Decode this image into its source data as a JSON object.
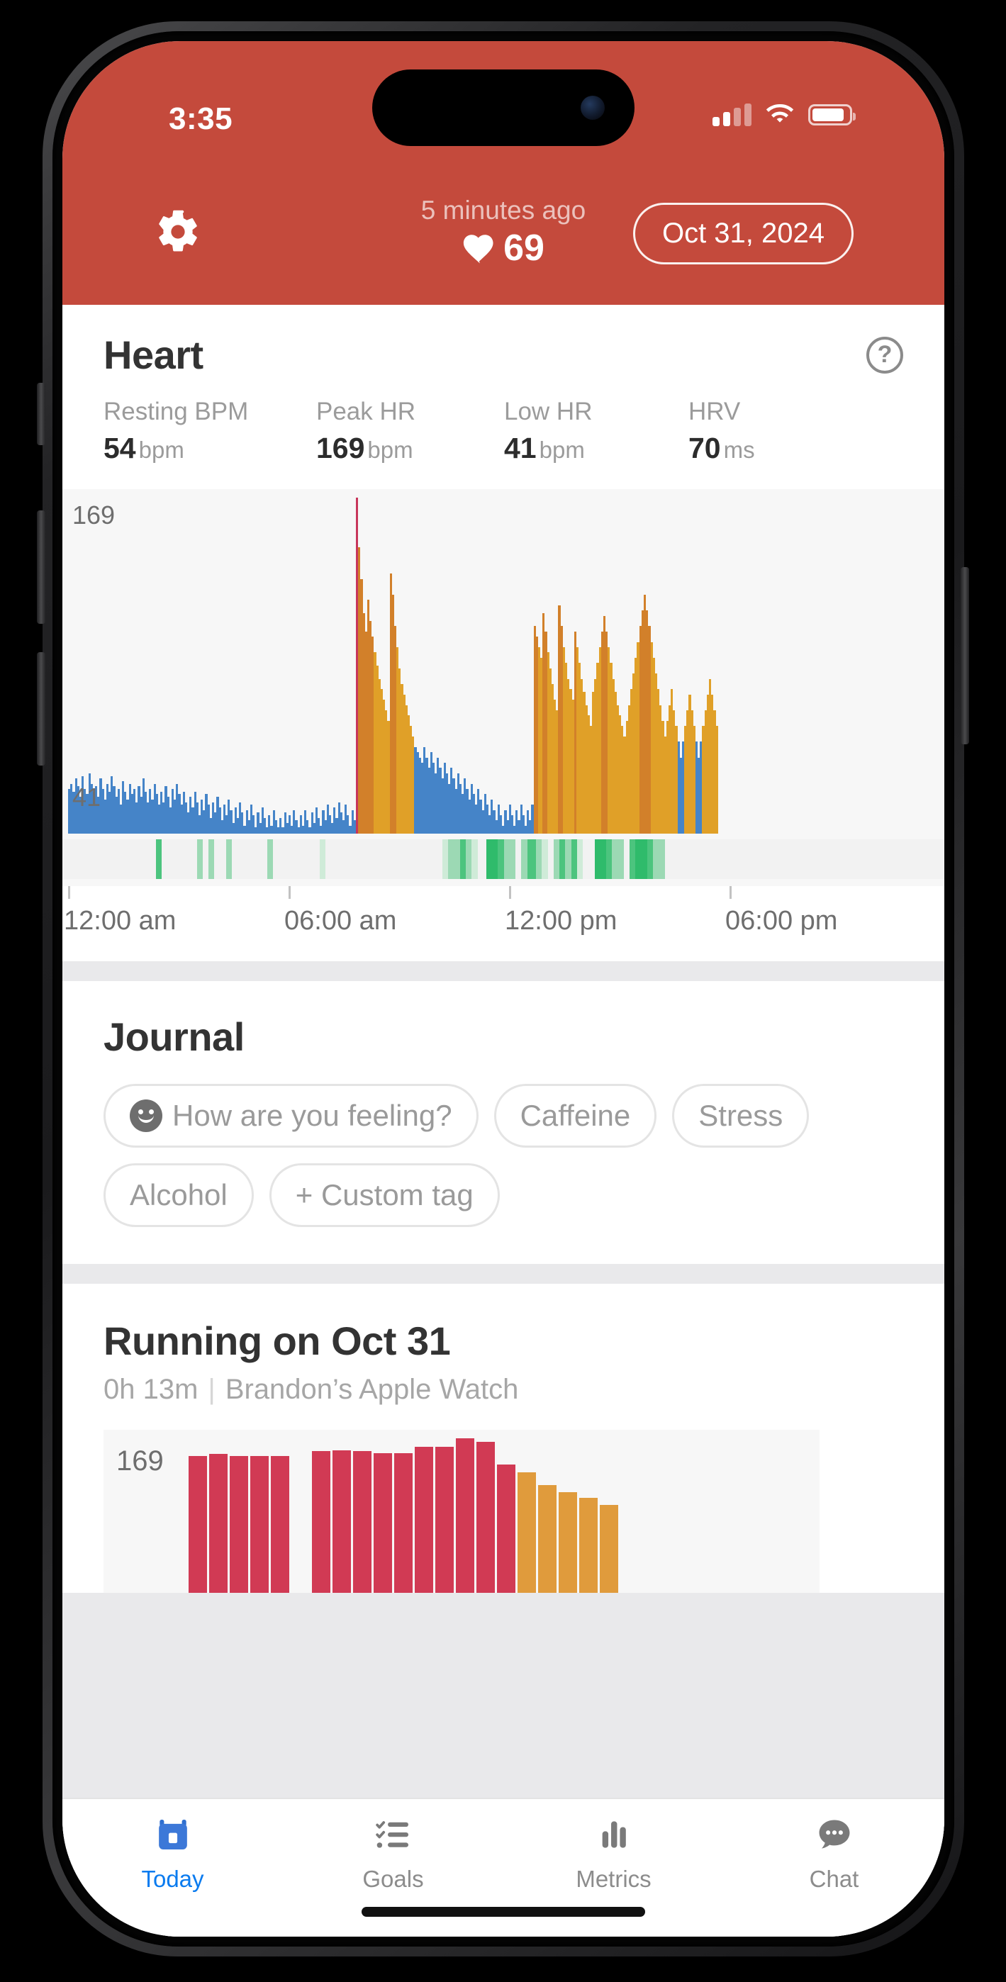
{
  "status_bar": {
    "time": "3:35",
    "signal_icon": "cellular-signal-icon",
    "wifi_icon": "wifi-icon",
    "battery_icon": "battery-icon"
  },
  "header": {
    "settings_icon": "gear-icon",
    "last_reading_ago": "5 minutes ago",
    "heart_icon": "heart-icon",
    "current_bpm": "69",
    "date_pill": "Oct 31, 2024",
    "accent_color": "#C44A3C"
  },
  "heart_card": {
    "title": "Heart",
    "help_icon": "question-mark-icon",
    "help_label": "?",
    "stats": [
      {
        "label": "Resting BPM",
        "value": "54",
        "unit": "bpm"
      },
      {
        "label": "Peak HR",
        "value": "169",
        "unit": "bpm"
      },
      {
        "label": "Low HR",
        "value": "41",
        "unit": "bpm"
      },
      {
        "label": "HRV",
        "value": "70",
        "unit": "ms"
      }
    ]
  },
  "journal": {
    "title": "Journal",
    "chips": [
      {
        "label": "How are you feeling?",
        "icon": "smiley-face-icon"
      },
      {
        "label": "Caffeine",
        "icon": ""
      },
      {
        "label": "Stress",
        "icon": ""
      },
      {
        "label": "Alcohol",
        "icon": ""
      },
      {
        "label": "+ Custom tag",
        "icon": ""
      }
    ]
  },
  "workout_card": {
    "title": "Running on Oct 31",
    "duration": "0h 13m",
    "separator": "|",
    "source": "Brandon’s Apple Watch",
    "max_label": "169"
  },
  "tab_bar": {
    "items": [
      {
        "label": "Today",
        "icon": "calendar-icon",
        "active": true
      },
      {
        "label": "Goals",
        "icon": "checklist-icon",
        "active": false
      },
      {
        "label": "Metrics",
        "icon": "bar-chart-icon",
        "active": false
      },
      {
        "label": "Chat",
        "icon": "speech-bubble-icon",
        "active": false
      }
    ],
    "active_color": "#0A7BEF",
    "inactive_color": "#8C8C8C"
  },
  "chart_data": [
    {
      "id": "day_heart_rate",
      "type": "bar",
      "title": "Heart",
      "xlabel": "",
      "ylabel": "bpm",
      "ylim": [
        41,
        169
      ],
      "ymax_label": "169",
      "ymin_label": "41",
      "grid": false,
      "legend": "none",
      "xtick_labels": [
        "12:00 am",
        "06:00 am",
        "12:00 pm",
        "06:00 pm"
      ],
      "xtick_positions_pct": [
        0,
        25,
        50,
        75
      ],
      "zone_colors": {
        "rest": "#4584C8",
        "moderate": "#E0A028",
        "vigorous": "#D2802A",
        "peak": "#C8365B"
      },
      "values": [
        58,
        60,
        57,
        62,
        59,
        55,
        63,
        58,
        56,
        64,
        60,
        57,
        59,
        55,
        62,
        58,
        54,
        60,
        57,
        63,
        59,
        55,
        58,
        52,
        61,
        57,
        54,
        60,
        56,
        58,
        53,
        59,
        55,
        62,
        57,
        53,
        58,
        54,
        60,
        56,
        52,
        57,
        53,
        59,
        55,
        51,
        58,
        54,
        60,
        56,
        52,
        57,
        53,
        49,
        55,
        51,
        57,
        53,
        48,
        54,
        50,
        56,
        52,
        47,
        53,
        49,
        55,
        51,
        46,
        52,
        48,
        54,
        50,
        45,
        51,
        47,
        53,
        49,
        44,
        50,
        46,
        52,
        48,
        43,
        49,
        45,
        51,
        47,
        42,
        48,
        44,
        50,
        46,
        41,
        47,
        43,
        49,
        45,
        48,
        44,
        50,
        46,
        42,
        48,
        44,
        50,
        46,
        43,
        49,
        45,
        51,
        47,
        44,
        50,
        46,
        52,
        48,
        45,
        51,
        47,
        53,
        49,
        46,
        52,
        48,
        44,
        50,
        46,
        169,
        150,
        138,
        125,
        118,
        130,
        122,
        116,
        110,
        105,
        100,
        96,
        92,
        88,
        84,
        140,
        132,
        120,
        112,
        104,
        98,
        94,
        90,
        86,
        82,
        78,
        74,
        72,
        70,
        68,
        74,
        70,
        66,
        72,
        68,
        64,
        70,
        66,
        62,
        68,
        64,
        60,
        66,
        62,
        58,
        64,
        60,
        56,
        62,
        58,
        54,
        60,
        56,
        52,
        58,
        54,
        50,
        56,
        52,
        48,
        54,
        50,
        46,
        52,
        48,
        44,
        50,
        46,
        52,
        48,
        44,
        50,
        46,
        52,
        48,
        44,
        50,
        46,
        52,
        120,
        116,
        112,
        108,
        125,
        118,
        110,
        104,
        98,
        92,
        88,
        128,
        120,
        112,
        106,
        100,
        96,
        92,
        118,
        112,
        106,
        100,
        95,
        90,
        86,
        82,
        95,
        100,
        106,
        112,
        118,
        124,
        118,
        112,
        106,
        100,
        95,
        90,
        86,
        82,
        78,
        84,
        90,
        96,
        102,
        108,
        114,
        120,
        126,
        132,
        126,
        120,
        114,
        108,
        102,
        96,
        90,
        84,
        78,
        84,
        90,
        96,
        88,
        82,
        76,
        70,
        76,
        82,
        88,
        94,
        88,
        82,
        76,
        70,
        76,
        82,
        88,
        94,
        100,
        94,
        88,
        82,
        0,
        0,
        0,
        0,
        0,
        0,
        0,
        0,
        0,
        0,
        0,
        0,
        0,
        0,
        0,
        0,
        0,
        0,
        0,
        0,
        0,
        0,
        0,
        0,
        0,
        0,
        0,
        0,
        0,
        0,
        0,
        0,
        0,
        0,
        0,
        0,
        0,
        0,
        0,
        0,
        0,
        0,
        0,
        0,
        0,
        0,
        0,
        0,
        0,
        0,
        0,
        0,
        0,
        0,
        0,
        0,
        0,
        0,
        0,
        0,
        0,
        0,
        0,
        0,
        0,
        0,
        0,
        0,
        0,
        0,
        0,
        0,
        0,
        0,
        0,
        0,
        0,
        0,
        0,
        0,
        0,
        0,
        0,
        0,
        0,
        0,
        0,
        0,
        0,
        0,
        0,
        0,
        0,
        0,
        0,
        0,
        0,
        0,
        0,
        0
      ],
      "activity_strip": {
        "label": "activity-intensity-strip",
        "color_scale": [
          "#F2F2F2",
          "#CFEBD8",
          "#9CD9B4",
          "#4CC47E",
          "#2FBB6B"
        ],
        "values": [
          0,
          0,
          0,
          0,
          0,
          0,
          0,
          0,
          0,
          0,
          0,
          0,
          0,
          0,
          0,
          0,
          0,
          0,
          0,
          0,
          0,
          0,
          0,
          0,
          0,
          0,
          0,
          0,
          0,
          0,
          3,
          3,
          0,
          0,
          0,
          0,
          0,
          0,
          0,
          0,
          0,
          0,
          0,
          0,
          2,
          2,
          0,
          0,
          2,
          2,
          0,
          0,
          0,
          0,
          2,
          2,
          0,
          0,
          0,
          0,
          0,
          0,
          0,
          0,
          0,
          0,
          0,
          0,
          2,
          2,
          0,
          0,
          0,
          0,
          0,
          0,
          0,
          0,
          0,
          0,
          0,
          0,
          0,
          0,
          0,
          0,
          1,
          1,
          0,
          0,
          0,
          0,
          0,
          0,
          0,
          0,
          0,
          0,
          0,
          0,
          0,
          0,
          0,
          0,
          0,
          0,
          0,
          0,
          0,
          0,
          0,
          0,
          0,
          0,
          0,
          0,
          0,
          0,
          0,
          0,
          0,
          0,
          0,
          0,
          0,
          0,
          0,
          0,
          1,
          1,
          2,
          2,
          2,
          2,
          3,
          3,
          2,
          2,
          1,
          1,
          0,
          0,
          0,
          4,
          4,
          4,
          4,
          3,
          3,
          2,
          2,
          2,
          2,
          0,
          0,
          2,
          2,
          3,
          3,
          3,
          2,
          2,
          1,
          1,
          0,
          0,
          2,
          2,
          3,
          3,
          2,
          2,
          3,
          3,
          1,
          1,
          0,
          0,
          0,
          0,
          4,
          4,
          4,
          4,
          3,
          3,
          2,
          2,
          2,
          2,
          0,
          0,
          3,
          3,
          4,
          4,
          4,
          4,
          3,
          3,
          2,
          2,
          2,
          2,
          0,
          0,
          0,
          0,
          0,
          0,
          0,
          0,
          0,
          0,
          0,
          0,
          0,
          0,
          0,
          0,
          0,
          0,
          0,
          0,
          0,
          0,
          0,
          0,
          0,
          0,
          0,
          0,
          0,
          0,
          0,
          0,
          0,
          0,
          0,
          0,
          0,
          0,
          0,
          0,
          0,
          0,
          0,
          0,
          0,
          0,
          0,
          0,
          0,
          0,
          0,
          0,
          0,
          0,
          0,
          0,
          0,
          0,
          0,
          0,
          0,
          0,
          0,
          0,
          0,
          0,
          0,
          0,
          0,
          0,
          0,
          0,
          0,
          0,
          0,
          0,
          0,
          0,
          0,
          0,
          0,
          0,
          0,
          0,
          0,
          0,
          0,
          0,
          0,
          0,
          0,
          0,
          0,
          0,
          0,
          0
        ]
      }
    },
    {
      "id": "workout_heart_rate",
      "type": "bar",
      "title": "Running on Oct 31",
      "xlabel": "",
      "ylabel": "bpm",
      "ylim": [
        0,
        169
      ],
      "ymax_label": "169",
      "grid": false,
      "legend": "none",
      "zone_colors": {
        "peak": "#D13A54",
        "vigorous": "#E09B3C"
      },
      "values": [
        150,
        152,
        150,
        150,
        150,
        0,
        155,
        156,
        155,
        153,
        153,
        160,
        160,
        169,
        165,
        140,
        132,
        118,
        110,
        104,
        96
      ],
      "value_colors": [
        "peak",
        "peak",
        "peak",
        "peak",
        "peak",
        "none",
        "peak",
        "peak",
        "peak",
        "peak",
        "peak",
        "peak",
        "peak",
        "peak",
        "peak",
        "peak",
        "vigorous",
        "vigorous",
        "vigorous",
        "vigorous",
        "vigorous"
      ]
    }
  ]
}
